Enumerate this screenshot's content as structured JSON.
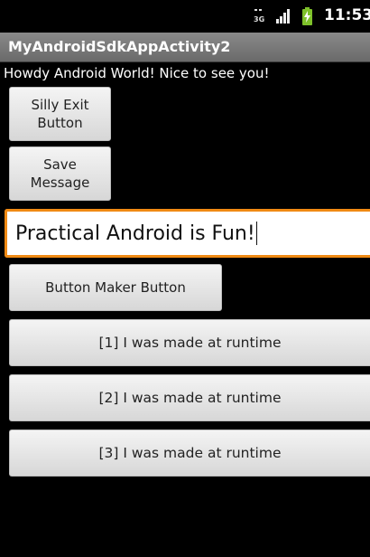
{
  "status_bar": {
    "network_label": "3G",
    "time": "11:53",
    "icons": [
      "3g-icon",
      "signal-bars-icon",
      "battery-charging-icon"
    ],
    "battery_color": "#7ec12a"
  },
  "title_bar": {
    "title": "MyAndroidSdkAppActivity2"
  },
  "greeting": "Howdy Android World! Nice to see you!",
  "buttons": {
    "silly_exit": "Silly Exit\nButton",
    "save_message": "Save\nMessage",
    "button_maker": "Button Maker Button"
  },
  "edit_text": {
    "value": "Practical Android is Fun!"
  },
  "runtime_buttons": [
    "[1] I was made at runtime",
    "[2] I was made at runtime",
    "[3] I was made at runtime"
  ],
  "colors": {
    "focus_border": "#f08a14",
    "background": "#000000",
    "title_bar": "#7a7a7a"
  }
}
